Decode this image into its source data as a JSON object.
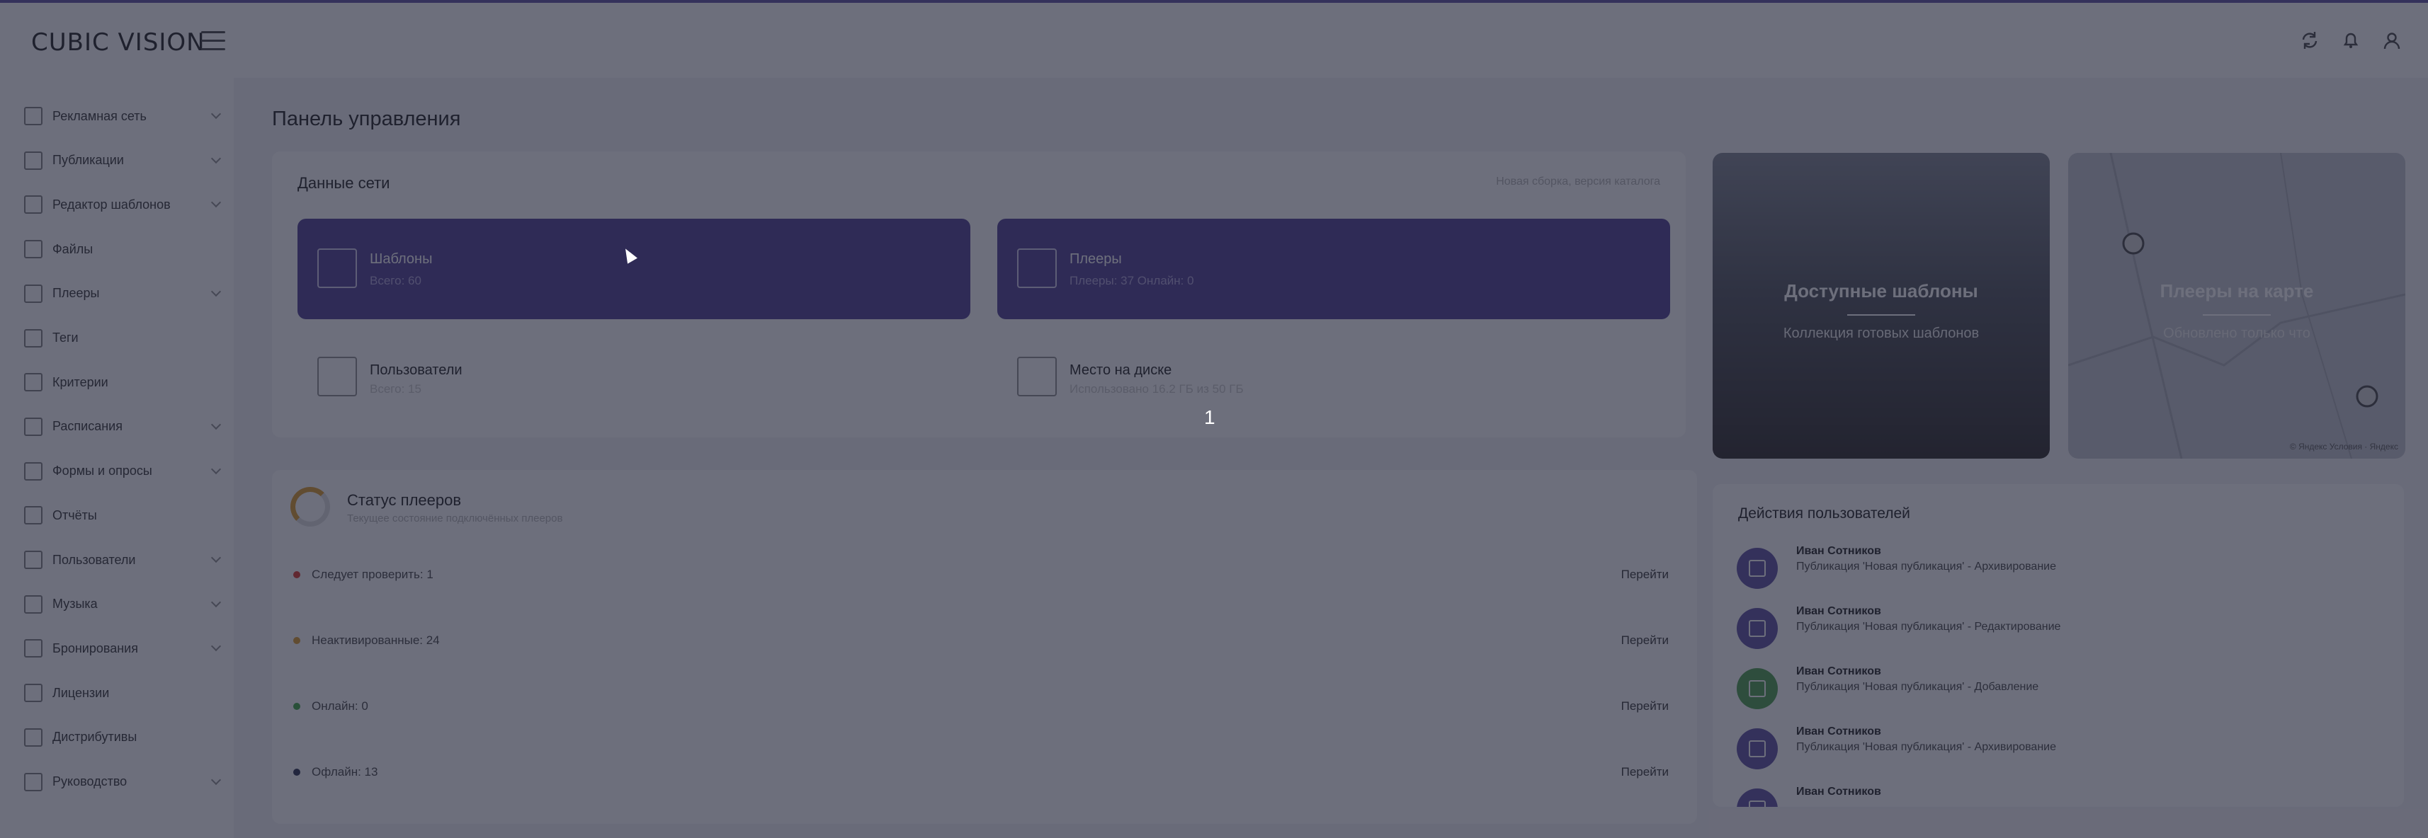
{
  "app": {
    "logo": "CUBIC VISION"
  },
  "header": {
    "icons": [
      "refresh-icon",
      "bell-icon",
      "user-icon"
    ]
  },
  "sidebar": {
    "items": [
      {
        "label": "Рекламная сеть",
        "icon": "network-icon",
        "has_submenu": true
      },
      {
        "label": "Публикации",
        "icon": "publication-icon",
        "has_submenu": true
      },
      {
        "label": "Редактор шаблонов",
        "icon": "template-editor-icon",
        "has_submenu": true
      },
      {
        "label": "Файлы",
        "icon": "file-icon",
        "has_submenu": false
      },
      {
        "label": "Плееры",
        "icon": "player-icon",
        "has_submenu": true
      },
      {
        "label": "Теги",
        "icon": "tag-icon",
        "has_submenu": false
      },
      {
        "label": "Критерии",
        "icon": "criteria-icon",
        "has_submenu": false
      },
      {
        "label": "Расписания",
        "icon": "schedule-icon",
        "has_submenu": true
      },
      {
        "label": "Формы и опросы",
        "icon": "form-icon",
        "has_submenu": true
      },
      {
        "label": "Отчёты",
        "icon": "report-icon",
        "has_submenu": false
      },
      {
        "label": "Пользователи",
        "icon": "users-icon",
        "has_submenu": true
      },
      {
        "label": "Музыка",
        "icon": "music-icon",
        "has_submenu": true
      },
      {
        "label": "Бронирования",
        "icon": "booking-icon",
        "has_submenu": true
      },
      {
        "label": "Лицензии",
        "icon": "license-icon",
        "has_submenu": false
      },
      {
        "label": "Дистрибутивы",
        "icon": "distributive-icon",
        "has_submenu": false
      },
      {
        "label": "Руководство",
        "icon": "manual-icon",
        "has_submenu": true
      }
    ]
  },
  "main": {
    "title": "Панель управления",
    "network": {
      "title": "Данные сети",
      "link": "Новая сборка, версия каталога",
      "tiles": [
        {
          "name": "Шаблоны",
          "sub": "Всего: 60",
          "icon": "template-icon",
          "style": "purple"
        },
        {
          "name": "Плееры",
          "sub": "Плееры: 37 Онлайн: 0",
          "icon": "player-icon",
          "style": "purple"
        },
        {
          "name": "Пользователи",
          "sub": "Всего: 15",
          "icon": "users-icon",
          "style": "light"
        },
        {
          "name": "Место на диске",
          "sub": "Использовано 16.2 ГБ из 50 ГБ",
          "icon": "folder-icon",
          "style": "light"
        }
      ]
    },
    "promos": [
      {
        "title": "Доступные шаблоны",
        "sub": "Коллекция готовых шаблонов"
      },
      {
        "title": "Плееры на карте",
        "sub": "Обновлено только что",
        "map_credit": "© Яндекс Условия · Яндекс"
      }
    ],
    "status": {
      "title": "Статус плееров",
      "sub": "Текущее состояние подключённых плееров",
      "rows": [
        {
          "label": "Следует проверить: 1",
          "color": "#e0463a",
          "action": "Перейти"
        },
        {
          "label": "Неактивированные: 24",
          "color": "#e0a23a",
          "action": "Перейти"
        },
        {
          "label": "Онлайн: 0",
          "color": "#4caf50",
          "action": "Перейти"
        },
        {
          "label": "Офлайн: 13",
          "color": "#3a3f5c",
          "action": "Перейти"
        }
      ]
    },
    "activity": {
      "title": "Действия пользователей",
      "rows": [
        {
          "name": "Иван Сотников",
          "desc": "Публикация 'Новая публикация' - Архивирование",
          "color": "#6a5da8"
        },
        {
          "name": "Иван Сотников",
          "desc": "Публикация 'Новая публикация' - Редактирование",
          "color": "#6a5da8"
        },
        {
          "name": "Иван Сотников",
          "desc": "Публикация 'Новая публикация' - Добавление",
          "color": "#5aa55a"
        },
        {
          "name": "Иван Сотников",
          "desc": "Публикация 'Новая публикация' - Архивирование",
          "color": "#6a5da8"
        },
        {
          "name": "Иван Сотников",
          "desc": "",
          "color": "#6a5da8"
        }
      ]
    }
  },
  "overlay": {
    "step_number": "1"
  }
}
